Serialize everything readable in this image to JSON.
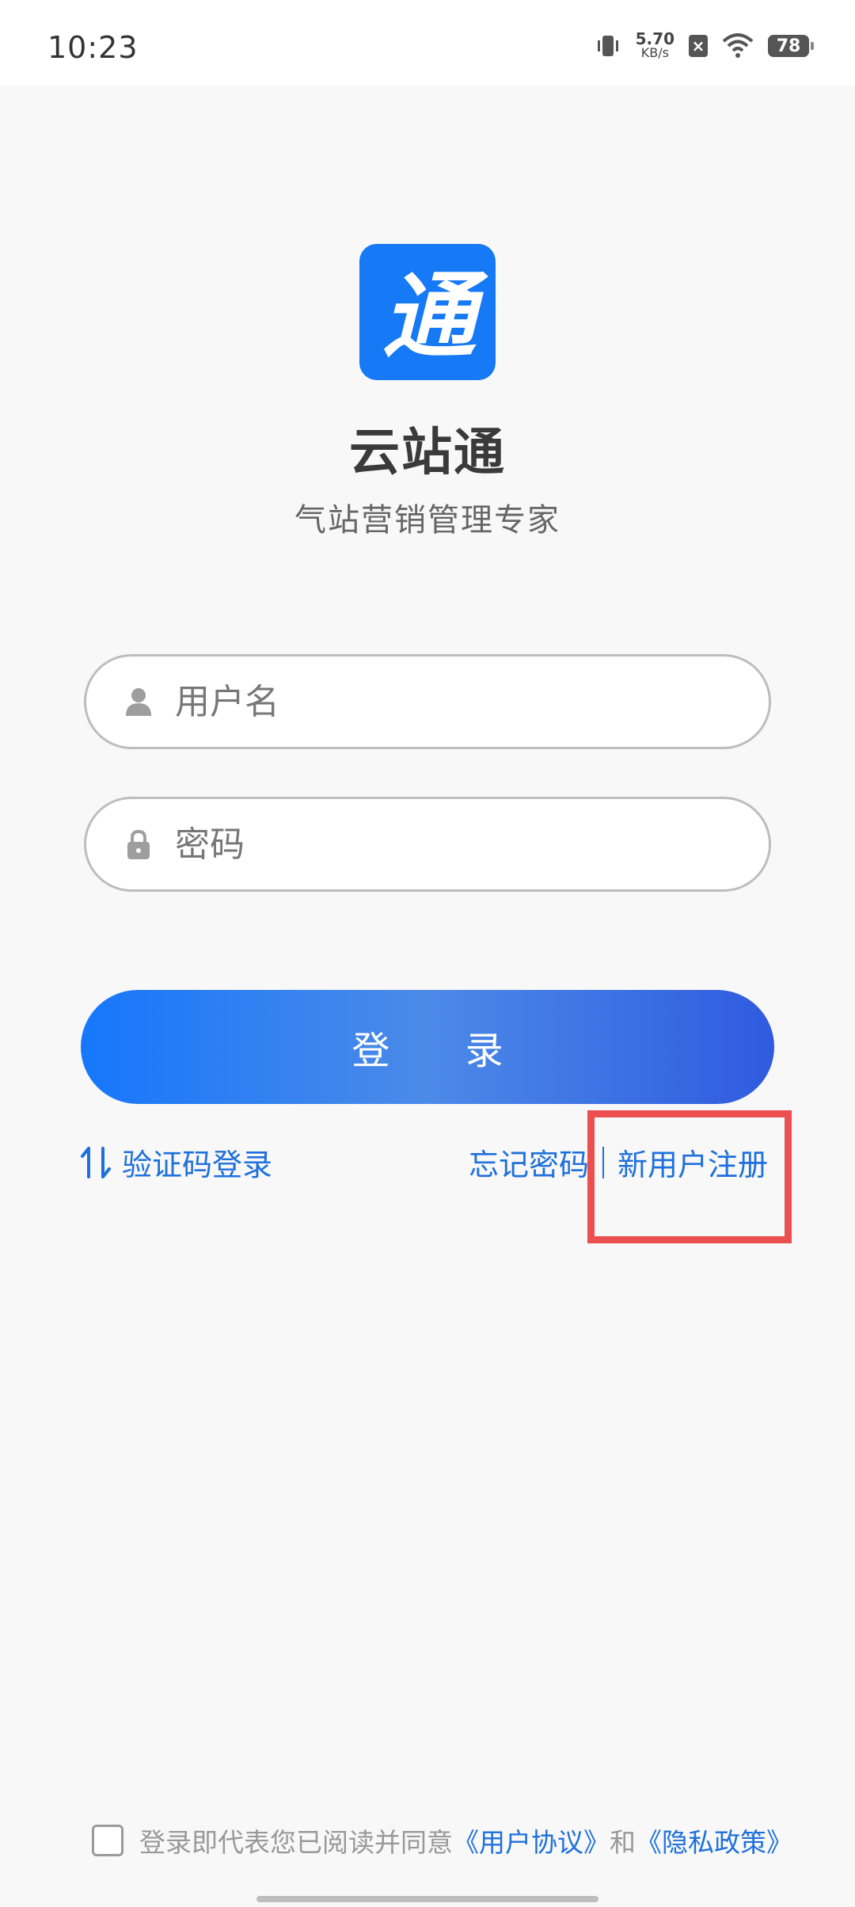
{
  "status_bar": {
    "time": "10:23",
    "net_speed_value": "5.70",
    "net_speed_unit": "KB/s",
    "sim_status": "×",
    "battery": "78",
    "icons": [
      "vibrate-icon",
      "sim-off-icon",
      "wifi-icon",
      "battery-icon"
    ]
  },
  "app": {
    "logo_glyph": "通",
    "name": "云站通",
    "slogan": "气站营销管理专家",
    "brand_color": "#1679f5"
  },
  "login_form": {
    "username_placeholder": "用户名",
    "username_value": "",
    "password_placeholder": "密码",
    "password_value": "",
    "login_label": "登 录"
  },
  "links": {
    "sms_login": "验证码登录",
    "forgot_password": "忘记密码",
    "register": "新用户注册",
    "link_color": "#1e70dc",
    "highlight_color": "#ec4f4f"
  },
  "agreement": {
    "checked": false,
    "prefix": "登录即代表您已阅读并同意",
    "user_agreement": "《用户协议》",
    "and": "和",
    "privacy_policy": "《隐私政策》"
  }
}
